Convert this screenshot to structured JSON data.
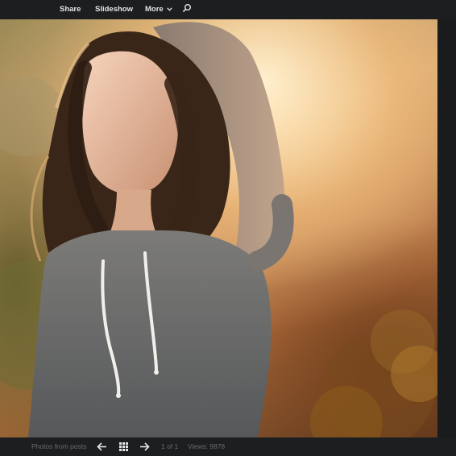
{
  "topbar": {
    "share_label": "Share",
    "slideshow_label": "Slideshow",
    "more_label": "More",
    "icons": {
      "more": "chevron-down-icon",
      "search": "search-icon"
    }
  },
  "photo": {
    "subject": "portrait-photo"
  },
  "bottombar": {
    "source_label": "Photos from posts",
    "position_text": "1 of 1",
    "views_text": "Views: 9878",
    "icons": {
      "prev": "arrow-left-icon",
      "grid": "grid-icon",
      "next": "arrow-right-icon"
    }
  },
  "colors": {
    "bar_background": "#1d1e20",
    "bar_text": "#e4e4e4",
    "muted_text": "#6c6d70"
  }
}
